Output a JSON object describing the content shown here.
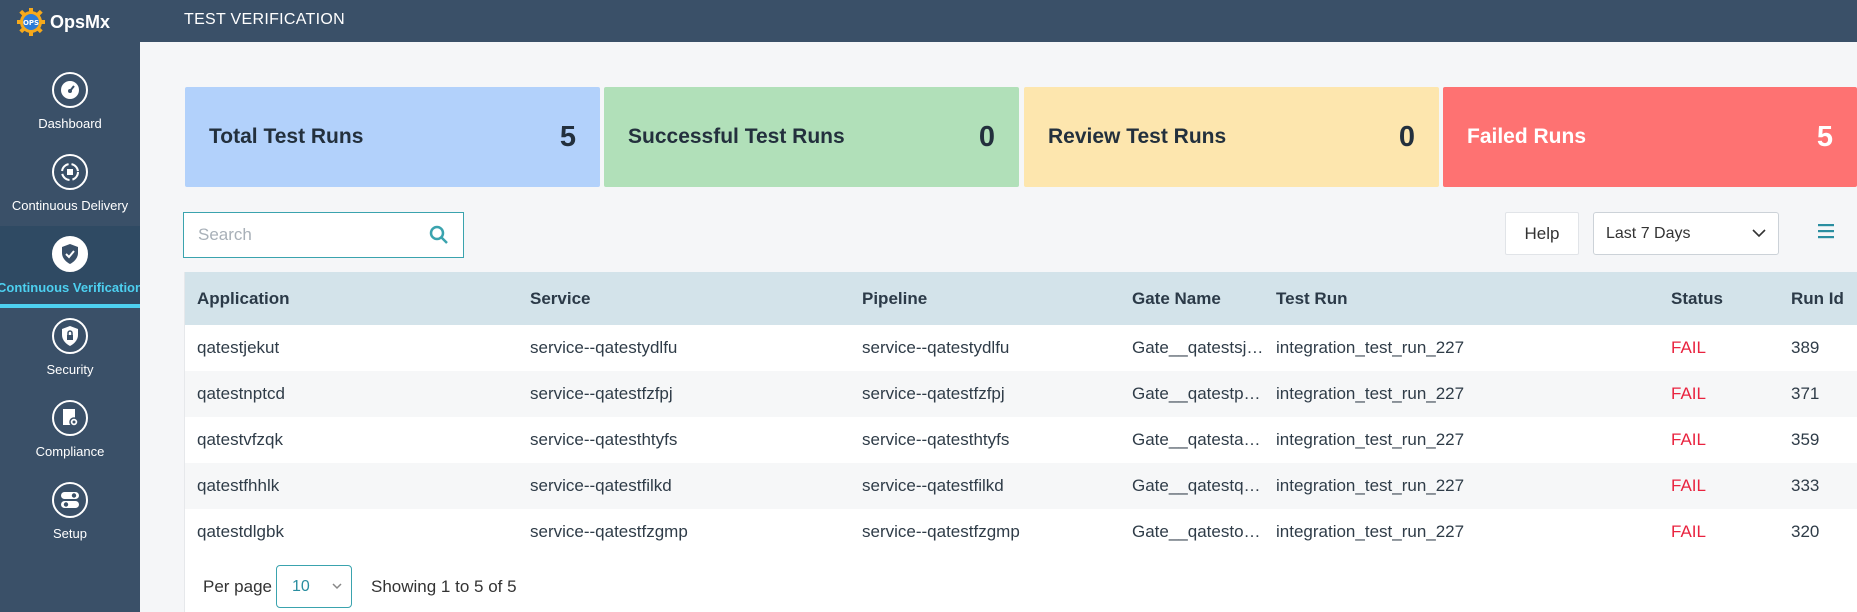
{
  "brand": {
    "name": "OpsMx"
  },
  "topbar": {
    "title": "TEST VERIFICATION"
  },
  "sidebar": {
    "items": [
      {
        "label": "Dashboard",
        "icon": "gauge-icon",
        "active": false
      },
      {
        "label": "Continuous Delivery",
        "icon": "cycle-icon",
        "active": false
      },
      {
        "label": "Continuous Verification",
        "icon": "shield-check-icon",
        "active": true
      },
      {
        "label": "Security",
        "icon": "lock-shield-icon",
        "active": false
      },
      {
        "label": "Compliance",
        "icon": "document-gear-icon",
        "active": false
      },
      {
        "label": "Setup",
        "icon": "toggle-icon",
        "active": false
      }
    ]
  },
  "summary": {
    "total": {
      "label": "Total Test Runs",
      "value": "5"
    },
    "success": {
      "label": "Successful Test Runs",
      "value": "0"
    },
    "review": {
      "label": "Review Test Runs",
      "value": "0"
    },
    "failed": {
      "label": "Failed Runs",
      "value": "5"
    }
  },
  "search": {
    "placeholder": "Search",
    "value": ""
  },
  "toolbar": {
    "help_label": "Help",
    "date_range": "Last 7 Days"
  },
  "table": {
    "columns": [
      "Application",
      "Service",
      "Pipeline",
      "Gate Name",
      "Test Run",
      "Status",
      "Run Id"
    ],
    "rows": [
      [
        "qatestjekut",
        "service--qatestydlfu",
        "service--qatestydlfu",
        "Gate__qatestsjstn",
        "integration_test_run_227",
        "FAIL",
        "389"
      ],
      [
        "qatestnptcd",
        "service--qatestfzfpj",
        "service--qatestfzfpj",
        "Gate__qatestp…",
        "integration_test_run_227",
        "FAIL",
        "371"
      ],
      [
        "qatestvfzqk",
        "service--qatesthtyfs",
        "service--qatesthtyfs",
        "Gate__qatestau…",
        "integration_test_run_227",
        "FAIL",
        "359"
      ],
      [
        "qatestfhhlk",
        "service--qatestfilkd",
        "service--qatestfilkd",
        "Gate__qatestq…",
        "integration_test_run_227",
        "FAIL",
        "333"
      ],
      [
        "qatestdlgbk",
        "service--qatestfzgmp",
        "service--qatestfzgmp",
        "Gate__qatestob…",
        "integration_test_run_227",
        "FAIL",
        "320"
      ]
    ]
  },
  "pagination": {
    "per_page_label": "Per page",
    "per_page_value": "10",
    "showing": "Showing 1 to 5 of 5"
  },
  "colors": {
    "accent": "#4dd0f0",
    "fail": "#e9233f",
    "sidebar": "#3a5068"
  }
}
